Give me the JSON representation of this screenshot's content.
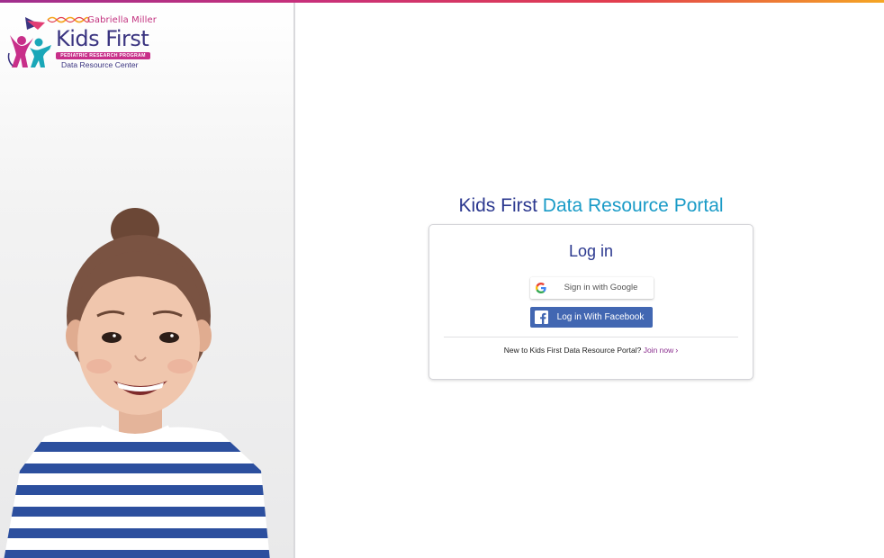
{
  "header": {
    "accent_gradient": [
      "#a02f8e",
      "#c8307a",
      "#e23d4e",
      "#f5a623"
    ]
  },
  "logo": {
    "line1": "Gabriella Miller",
    "line2": "Kids First",
    "line3": "PEDIATRIC RESEARCH PROGRAM",
    "line4": "Data Resource Center",
    "colors": {
      "navy": "#3a3480",
      "magenta": "#c82f89",
      "teal": "#1aa7b8"
    }
  },
  "hero": {
    "image": "smiling-child-photo"
  },
  "portal": {
    "title_part1": "Kids First",
    "title_part2": "Data Resource Portal",
    "colors": {
      "title": "#2b388f",
      "accent": "#1a9bc7"
    }
  },
  "login": {
    "heading": "Log in",
    "google_label": "Sign in with Google",
    "google_icon": "google-g-icon",
    "facebook_label": "Log in With Facebook",
    "facebook_icon": "facebook-f-icon",
    "facebook_color": "#4267b2",
    "signup_text": "New to Kids First Data Resource Portal?",
    "join_label": "Join now",
    "join_icon": "chevron-right-icon",
    "join_color": "#8a2d8e"
  }
}
